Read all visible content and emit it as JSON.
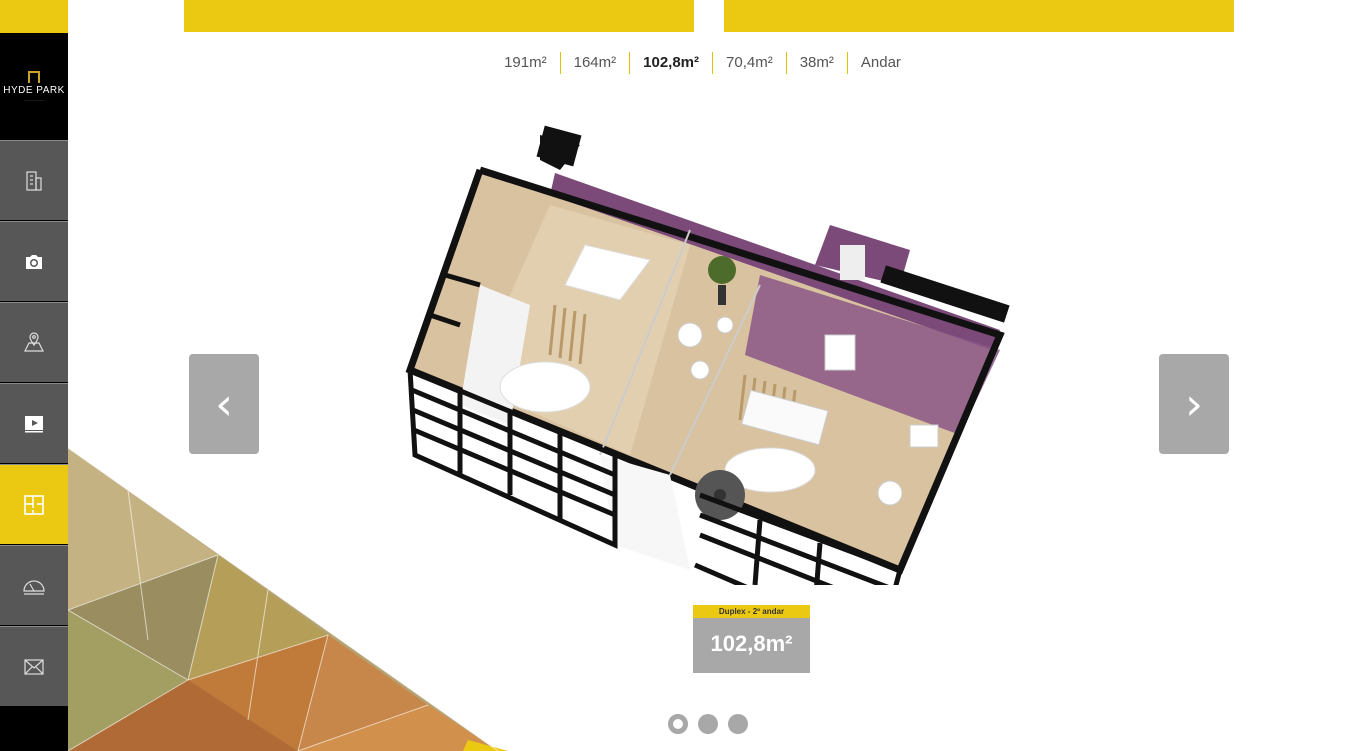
{
  "brand": {
    "logo_text": "HYDE PARK"
  },
  "sidebar": {
    "items": [
      {
        "name": "building-icon",
        "active": false
      },
      {
        "name": "camera-icon",
        "active": false
      },
      {
        "name": "map-pin-icon",
        "active": false
      },
      {
        "name": "video-icon",
        "active": false
      },
      {
        "name": "floorplan-icon",
        "active": true
      },
      {
        "name": "protractor-icon",
        "active": false
      },
      {
        "name": "mail-icon",
        "active": false
      }
    ]
  },
  "tabs": [
    {
      "label": "191m²",
      "active": false
    },
    {
      "label": "164m²",
      "active": false
    },
    {
      "label": "102,8m²",
      "active": true
    },
    {
      "label": "70,4m²",
      "active": false
    },
    {
      "label": "38m²",
      "active": false
    },
    {
      "label": "Andar",
      "active": false
    }
  ],
  "carousel": {
    "prev_label": "‹",
    "next_label": "›",
    "slide_count": 3,
    "active_slide": 0
  },
  "plan_label": {
    "tag": "Duplex - 2º andar",
    "value": "102,8m²"
  },
  "colors": {
    "accent": "#ebc812",
    "sidebar": "#575757",
    "arrow": "#a8a8a8",
    "wall_purple": "#7b4a78",
    "floor_wood": "#d9c2a0"
  }
}
